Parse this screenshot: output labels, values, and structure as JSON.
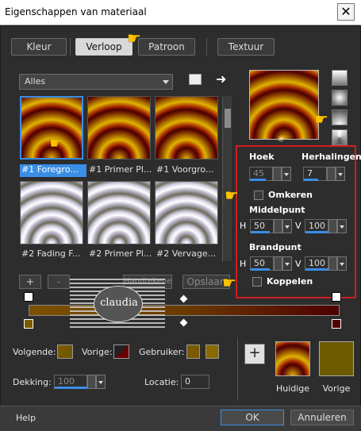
{
  "window": {
    "title": "Eigenschappen van materiaal",
    "close_glyph": "✕"
  },
  "tabs": [
    "Kleur",
    "Verloop",
    "Patroon",
    "Textuur"
  ],
  "library": {
    "filter_value": "Alles",
    "items": [
      "#1 Foregro...",
      "#1 Primer Pl...",
      "#1 Voorgro...",
      "#2 Fading F...",
      "#2 Primer Pl...",
      "#2 Vervage..."
    ]
  },
  "buttons": {
    "add": "+",
    "remove": "-",
    "save": "Opslaan",
    "dim_button": "Handtekenen"
  },
  "settings": {
    "hoek_label": "Hoek",
    "hoek_value": "45",
    "herhalingen_label": "Herhalingen",
    "herhalingen_value": "7",
    "omkeren_label": "Omkeren",
    "middelpunt_label": "Middelpunt",
    "middelpunt_h": "50",
    "middelpunt_v": "100",
    "brandpunt_label": "Brandpunt",
    "brandpunt_h": "50",
    "brandpunt_v": "100",
    "koppelen_label": "Koppelen",
    "h_label": "H",
    "v_label": "V"
  },
  "bottom": {
    "volgende_label": "Volgende:",
    "vorige_label": "Vorige:",
    "gebruiker_label": "Gebruiker:",
    "dekking_label": "Dekking:",
    "dekking_value": "100",
    "locatie_label": "Locatie:",
    "locatie_value": "0",
    "huidige_label": "Huidige",
    "vorige_preview_label": "Vorige",
    "plus": "+"
  },
  "footer": {
    "help": "Help",
    "ok": "OK",
    "cancel": "Annuleren"
  },
  "watermark": "claudia",
  "colors": {
    "accent": "#3a8ee6",
    "highlight_box": "#d01e1e",
    "gold": "#7a5a00",
    "dark_red": "#4d0000",
    "olive": "#6e5a00"
  }
}
